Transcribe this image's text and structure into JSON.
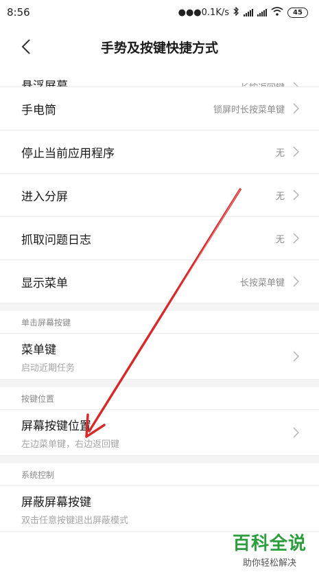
{
  "status_bar": {
    "time": "8:56",
    "speed": "●●●0.1K/s",
    "battery": "45"
  },
  "header": {
    "title": "手势及按键快捷方式"
  },
  "rows_top": [
    {
      "label": "悬浮屏幕",
      "value": "长按返回键"
    },
    {
      "label": "手电筒",
      "value": "锁屏时长按菜单键"
    },
    {
      "label": "停止当前应用程序",
      "value": "无"
    },
    {
      "label": "进入分屏",
      "value": "无"
    },
    {
      "label": "抓取问题日志",
      "value": "无"
    },
    {
      "label": "显示菜单",
      "value": "长按菜单键"
    }
  ],
  "section_single": {
    "title": "单击屏幕按键",
    "menu_key": {
      "label": "菜单键",
      "sub": "启动近期任务"
    }
  },
  "section_position": {
    "title": "按键位置",
    "item": {
      "label": "屏幕按键位置",
      "sub": "左边菜单键，右边返回键"
    }
  },
  "section_system": {
    "title": "系统控制",
    "item": {
      "label": "屏蔽屏幕按键",
      "sub": "双击任意按键退出屏蔽模式"
    }
  },
  "watermark": {
    "main": "百科全说",
    "sub": "助你轻松解决"
  }
}
